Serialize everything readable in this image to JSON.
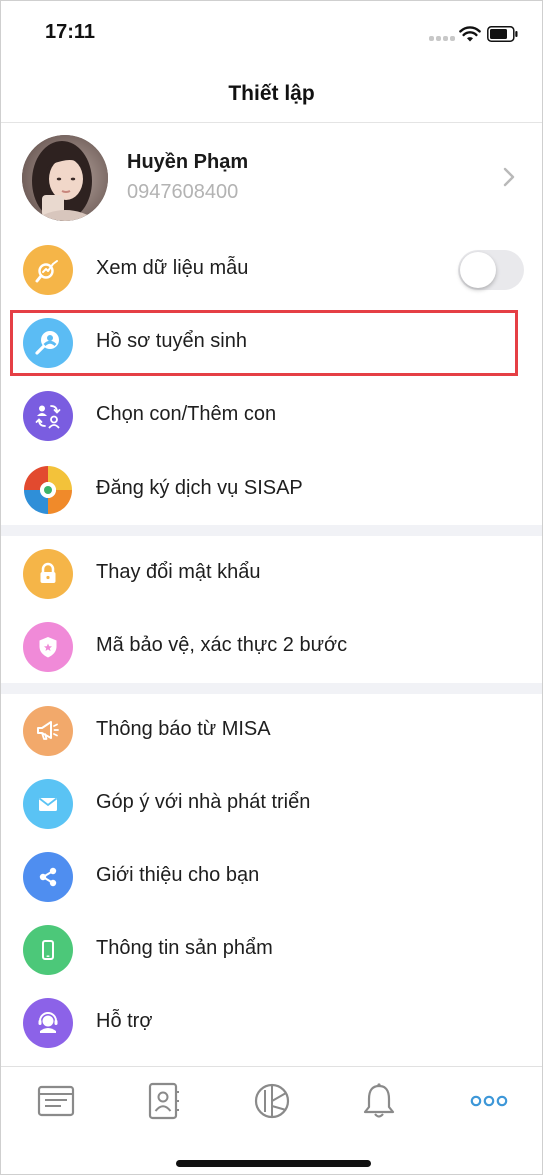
{
  "status_bar": {
    "time": "17:11"
  },
  "header": {
    "title": "Thiết lập"
  },
  "profile": {
    "name": "Huyền Phạm",
    "phone": "0947608400"
  },
  "menu": {
    "sample_data": {
      "label": "Xem dữ liệu mẫu",
      "icon": "sample-data-icon",
      "color": "#f5b548",
      "toggle_on": false
    },
    "items": [
      {
        "label": "Hồ sơ tuyển sinh",
        "icon": "admission-profile-icon",
        "color": "#5bbcf4",
        "highlighted": true
      },
      {
        "label": "Chọn con/Thêm con",
        "icon": "switch-child-icon",
        "color": "#7a5de0"
      },
      {
        "label": "Đăng ký dịch vụ SISAP",
        "icon": "sisap-logo-icon",
        "color": "#e24a2f"
      }
    ],
    "security": [
      {
        "label": "Thay đổi mật khẩu",
        "icon": "lock-icon",
        "color": "#f5b548"
      },
      {
        "label": "Mã bảo vệ, xác thực 2 bước",
        "icon": "shield-icon",
        "color": "#f08ad8"
      }
    ],
    "about": [
      {
        "label": "Thông báo từ MISA",
        "icon": "megaphone-icon",
        "color": "#f2a96b"
      },
      {
        "label": "Góp ý với nhà phát triển",
        "icon": "mail-icon",
        "color": "#5ac3f4"
      },
      {
        "label": "Giới thiệu cho bạn",
        "icon": "share-icon",
        "color": "#4f8ef0"
      },
      {
        "label": "Thông tin sản phẩm",
        "icon": "phone-icon",
        "color": "#4cc879"
      },
      {
        "label": "Hỗ trợ",
        "icon": "support-agent-icon",
        "color": "#8c62e8"
      }
    ]
  },
  "tabbar": {
    "tabs": [
      "news-icon",
      "contacts-icon",
      "report-chart-icon",
      "notification-bell-icon",
      "more-dots-icon"
    ],
    "active_color": "#3d97d8",
    "inactive_color": "#8a8a8a"
  },
  "colors": {
    "highlight_border": "#e53f45",
    "separator": "#f1f2f6"
  }
}
